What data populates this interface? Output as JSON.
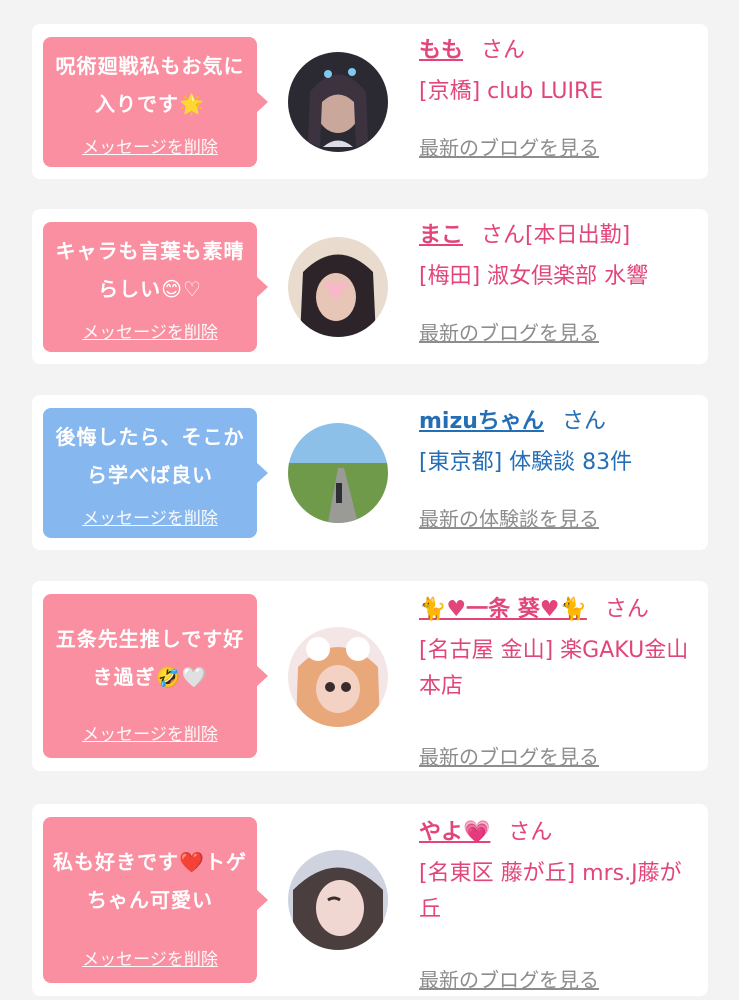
{
  "cards": [
    {
      "message": "呪術廻戦私もお気に入りです🌟",
      "delete_label": "メッセージを削除",
      "name": "もも",
      "san": "さん",
      "shop": "[京橋] club LUIRE",
      "more": "最新のブログを見る",
      "theme": "pink"
    },
    {
      "message": "キャラも言葉も素晴らしい😊♡",
      "delete_label": "メッセージを削除",
      "name": "まこ",
      "san": "さん[本日出勤]",
      "shop": "[梅田] 淑女倶楽部 水響",
      "more": "最新のブログを見る",
      "theme": "pink"
    },
    {
      "message": "後悔したら、そこから学べば良い",
      "delete_label": "メッセージを削除",
      "name": "mizuちゃん",
      "san": "さん",
      "shop": "[東京都] 体験談 83件",
      "more": "最新の体験談を見る",
      "theme": "blue"
    },
    {
      "message": "五条先生推しです好き過ぎ🤣🤍",
      "delete_label": "メッセージを削除",
      "name": "🐈♥一条 葵♥🐈",
      "san": "さん",
      "shop": "[名古屋 金山] 楽GAKU金山本店",
      "more": "最新のブログを見る",
      "theme": "pink"
    },
    {
      "message": "私も好きです❤️トゲちゃん可愛い",
      "delete_label": "メッセージを削除",
      "name": "やよ💗",
      "san": "さん",
      "shop": "[名東区 藤が丘] mrs.J藤が丘",
      "more": "最新のブログを見る",
      "theme": "pink"
    }
  ],
  "colors": {
    "pink_bubble": "#f98fa0",
    "blue_bubble": "#87b7ef",
    "pink_text": "#e2457b",
    "blue_text": "#236eb5",
    "link_gray": "#8d8d8d"
  }
}
